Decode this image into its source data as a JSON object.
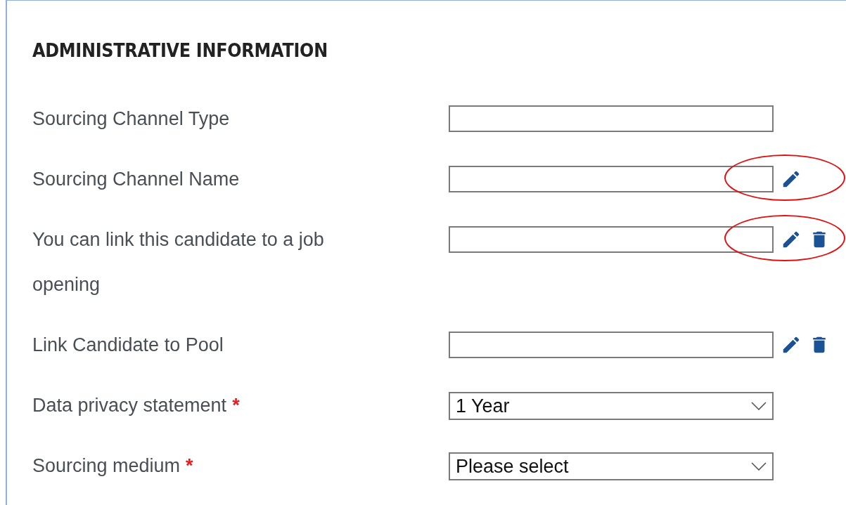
{
  "section": {
    "title": "ADMINISTRATIVE INFORMATION"
  },
  "fields": [
    {
      "label": "Sourcing Channel Type",
      "required": false,
      "kind": "text",
      "editable": false,
      "deletable": false,
      "highlighted": false
    },
    {
      "label": "Sourcing Channel Name",
      "required": false,
      "kind": "text",
      "editable": true,
      "deletable": false,
      "highlighted": true
    },
    {
      "label": "You can link this candidate to a job opening",
      "required": false,
      "kind": "text",
      "editable": true,
      "deletable": true,
      "highlighted": true
    },
    {
      "label": "Link Candidate to Pool",
      "required": false,
      "kind": "text",
      "editable": true,
      "deletable": true,
      "highlighted": false
    },
    {
      "label": "Data privacy statement",
      "required": true,
      "required_mark": "*",
      "kind": "select",
      "value": "1 Year",
      "editable": false,
      "deletable": false,
      "highlighted": false
    },
    {
      "label": "Sourcing medium",
      "required": true,
      "required_mark": "*",
      "kind": "select",
      "value": "Please select",
      "editable": false,
      "deletable": false,
      "highlighted": false
    }
  ]
}
